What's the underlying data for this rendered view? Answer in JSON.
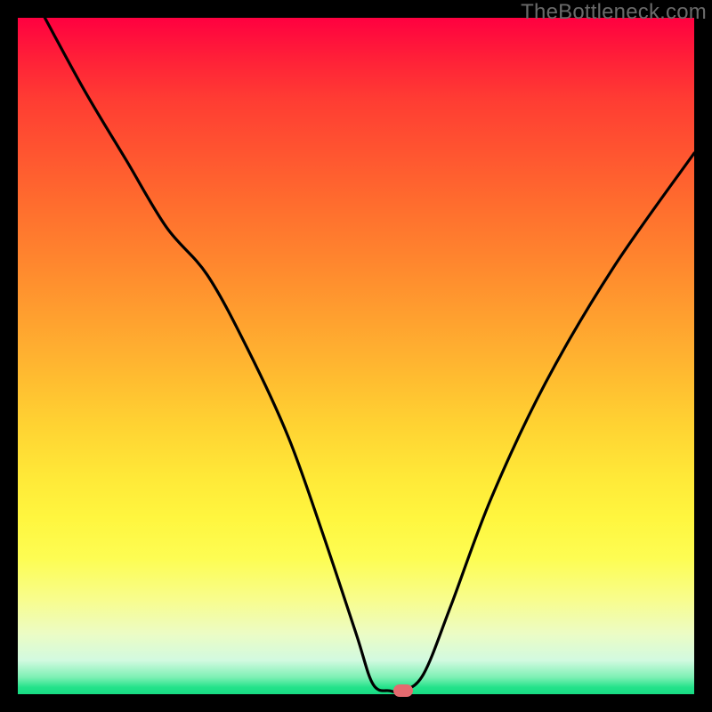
{
  "watermark": "TheBottleneck.com",
  "chart_data": {
    "type": "line",
    "title": "",
    "xlabel": "",
    "ylabel": "",
    "xlim": [
      0,
      100
    ],
    "ylim": [
      0,
      100
    ],
    "grid": false,
    "legend": false,
    "curve": {
      "name": "bottleneck-curve",
      "color": "#000000",
      "x": [
        4,
        10,
        16,
        22,
        28,
        34,
        40,
        45,
        50,
        52.5,
        55,
        57,
        60,
        64,
        70,
        78,
        88,
        100
      ],
      "y": [
        100,
        89,
        79,
        69,
        62,
        51,
        38,
        24,
        9,
        1.5,
        0.5,
        0.5,
        3,
        13,
        29,
        46,
        63,
        80
      ]
    },
    "marker": {
      "x": 57,
      "y": 0.5,
      "color": "#e46a6f"
    }
  },
  "background_gradient": {
    "top_color": "#ff0040",
    "mid_color": "#ffe938",
    "bottom_color": "#17db83"
  }
}
